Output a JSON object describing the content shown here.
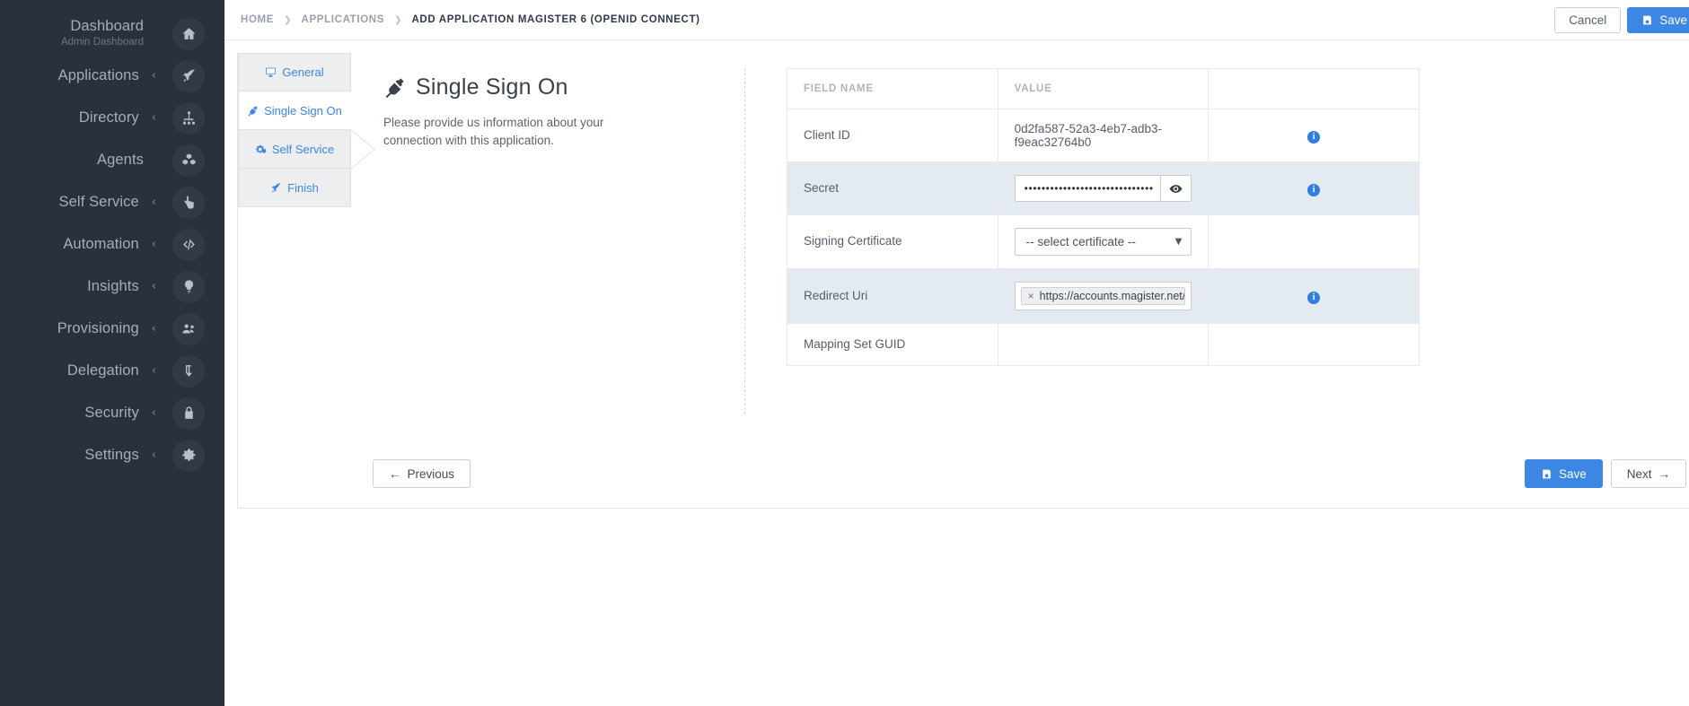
{
  "sidebar": {
    "items": [
      {
        "label": "Dashboard",
        "sub": "Admin Dashboard",
        "icon": "home-icon",
        "caret": ""
      },
      {
        "label": "Applications",
        "sub": "",
        "icon": "rocket-icon",
        "caret": "‹"
      },
      {
        "label": "Directory",
        "sub": "",
        "icon": "sitemap-icon",
        "caret": "‹"
      },
      {
        "label": "Agents",
        "sub": "",
        "icon": "cubes-icon",
        "caret": ""
      },
      {
        "label": "Self Service",
        "sub": "",
        "icon": "hand-pointer-icon",
        "caret": "‹"
      },
      {
        "label": "Automation",
        "sub": "",
        "icon": "code-icon",
        "caret": "‹"
      },
      {
        "label": "Insights",
        "sub": "",
        "icon": "lightbulb-icon",
        "caret": "‹"
      },
      {
        "label": "Provisioning",
        "sub": "",
        "icon": "users-icon",
        "caret": "‹"
      },
      {
        "label": "Delegation",
        "sub": "",
        "icon": "level-down-icon",
        "caret": "‹"
      },
      {
        "label": "Security",
        "sub": "",
        "icon": "lock-icon",
        "caret": "‹"
      },
      {
        "label": "Settings",
        "sub": "",
        "icon": "gear-icon",
        "caret": "‹"
      }
    ]
  },
  "topbar": {
    "breadcrumb": [
      {
        "label": "HOME"
      },
      {
        "label": "APPLICATIONS"
      },
      {
        "label": "ADD APPLICATION MAGISTER 6 (OPENID CONNECT)"
      }
    ],
    "separator": "❯",
    "cancel_label": "Cancel",
    "save_label": "Save"
  },
  "wizard": {
    "tabs": [
      {
        "label": "General",
        "icon": "monitor-icon",
        "active": false
      },
      {
        "label": "Single Sign On",
        "icon": "plug-icon",
        "active": true
      },
      {
        "label": "Self Service",
        "icon": "gears-icon",
        "active": false
      },
      {
        "label": "Finish",
        "icon": "rocket-icon",
        "active": false
      }
    ],
    "pane": {
      "title": "Single Sign On",
      "title_icon": "plug-icon",
      "description": "Please provide us information about your connection with this application."
    },
    "table": {
      "headers": [
        "FIELD NAME",
        "VALUE",
        ""
      ],
      "rows": [
        {
          "name": "Client ID",
          "type": "text",
          "value": "0d2fa587-52a3-4eb7-adb3-f9eac32764b0",
          "info": true,
          "highlight": false
        },
        {
          "name": "Secret",
          "type": "password",
          "value": "••••••••••••••••••••••••••••••",
          "reveal_icon": "eye-icon",
          "info": true,
          "highlight": true
        },
        {
          "name": "Signing Certificate",
          "type": "select",
          "value": "-- select certificate --",
          "info": false,
          "highlight": false
        },
        {
          "name": "Redirect Uri",
          "type": "tags",
          "tag_remove": "×",
          "value": "https://accounts.magister.net/ExternalLogin/OidcSignin",
          "info": true,
          "highlight": true
        },
        {
          "name": "Mapping Set GUID",
          "type": "empty",
          "value": "",
          "info": false,
          "highlight": false
        }
      ],
      "info_glyph": "i"
    },
    "footer": {
      "previous_label": "Previous",
      "previous_arrow": "←",
      "save_label": "Save",
      "next_label": "Next",
      "next_arrow": "→"
    }
  },
  "colors": {
    "accent": "#3d87e4",
    "sidebar_bg": "#2b313c",
    "row_highlight": "#e4eaf2",
    "info_blue": "#2f7fe0"
  }
}
